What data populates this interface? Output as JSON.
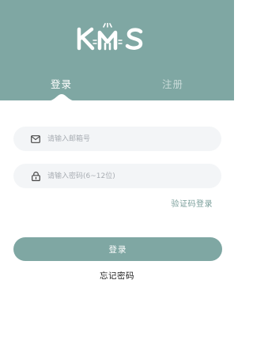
{
  "header": {
    "logo_text": "KMS",
    "tabs": [
      {
        "label": "登录",
        "active": true
      },
      {
        "label": "注册",
        "active": false
      }
    ]
  },
  "form": {
    "email": {
      "placeholder": "请输入邮箱号",
      "value": "",
      "icon": "envelope-icon"
    },
    "password": {
      "placeholder": "请输入密码(6~12位)",
      "value": "",
      "icon": "lock-icon"
    },
    "sms_login_label": "验证码登录",
    "submit_label": "登录",
    "forgot_label": "忘记密码"
  },
  "colors": {
    "brand": "#7fa7a3",
    "input_bg": "#f3f5f7",
    "link": "#7a9e9a"
  }
}
